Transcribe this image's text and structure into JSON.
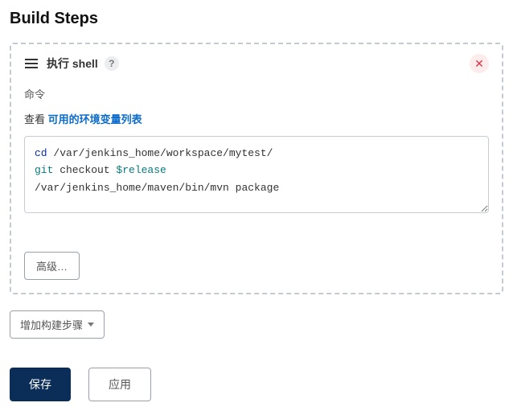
{
  "section_title": "Build Steps",
  "step": {
    "title": "执行 shell",
    "help_char": "?",
    "close_char": "✕",
    "command_label": "命令",
    "helper_prefix": "查看 ",
    "helper_link": "可用的环境变量列表",
    "code_tokens": [
      {
        "t": "cd",
        "c": "kw1"
      },
      {
        "t": " /var/jenkins_home/workspace/mytest/",
        "c": ""
      },
      {
        "t": "\n",
        "c": ""
      },
      {
        "t": "git",
        "c": "kw2"
      },
      {
        "t": " checkout ",
        "c": ""
      },
      {
        "t": "$release",
        "c": "var"
      },
      {
        "t": "\n",
        "c": ""
      },
      {
        "t": "/var/jenkins_home/maven/bin/mvn package",
        "c": ""
      }
    ],
    "advanced_label": "高级…"
  },
  "add_step_label": "增加构建步骤",
  "save_label": "保存",
  "apply_label": "应用"
}
